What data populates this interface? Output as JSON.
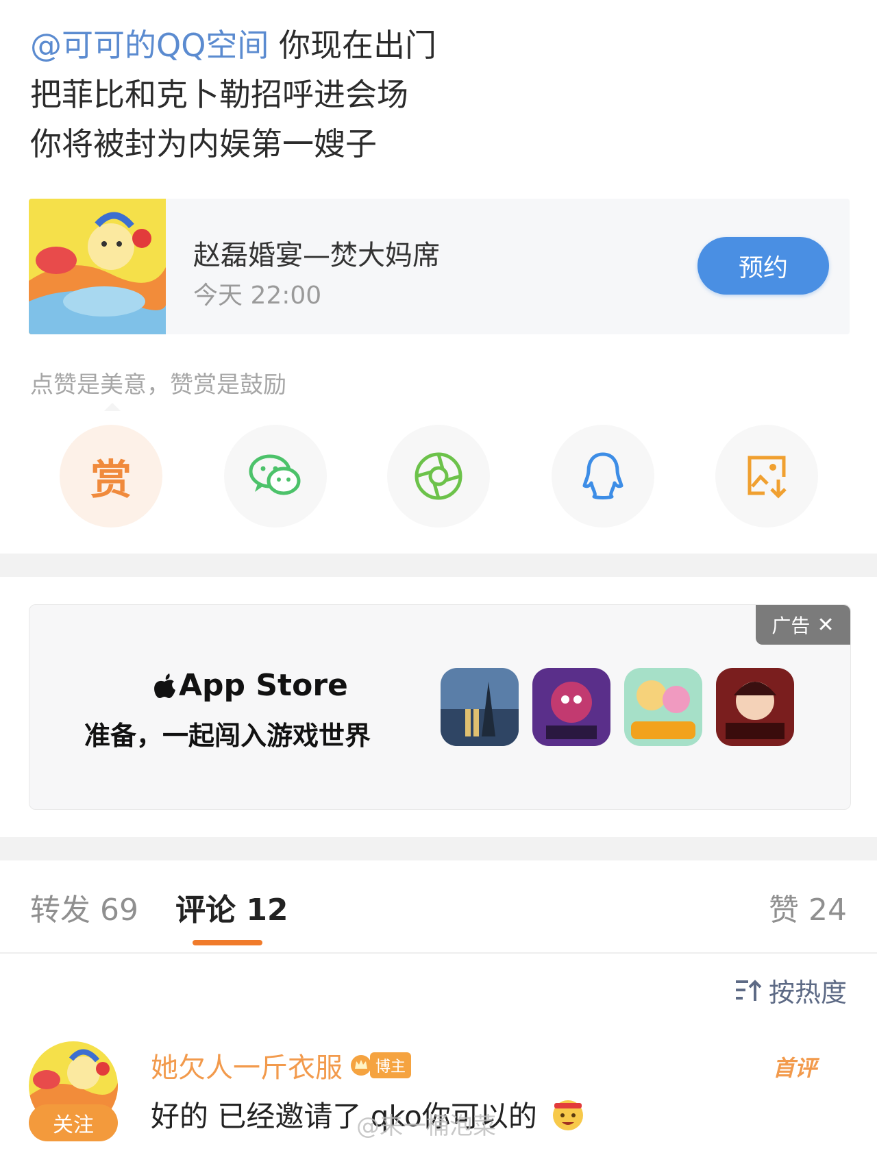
{
  "post": {
    "mention": "@可可的QQ空间",
    "line1_rest": " 你现在出门",
    "line2": "把菲比和克卜勒招呼进会场",
    "line3": "你将被封为内娱第一嫂子"
  },
  "event_card": {
    "title": "赵磊婚宴—焚大妈席",
    "time": "今天 22:00",
    "reserve_label": "预约"
  },
  "reward_tip": "点赞是美意，赞赏是鼓励",
  "share": {
    "reward_label": "赏",
    "icons": [
      "reward-icon",
      "wechat-icon",
      "moments-icon",
      "qq-icon",
      "save-image-icon"
    ]
  },
  "ad": {
    "tag": "广告",
    "brand": "App Store",
    "slogan": "准备，一起闯入游戏世界",
    "apps": [
      "app-icon-1",
      "app-icon-2",
      "app-icon-3",
      "app-icon-4"
    ]
  },
  "tabs": {
    "repost": "转发 69",
    "comment": "评论 12",
    "like": "赞 24"
  },
  "sort_label": "按热度",
  "comment": {
    "follow_label": "关注",
    "user": "她欠人一斤衣服",
    "badge": "博主",
    "first_tag": "首评",
    "text": "好的 已经邀请了 qko你可以的"
  },
  "watermark": "@来一桶泡菜",
  "colors": {
    "mention": "#5b8bd0",
    "reserve_button": "#4a8fe3",
    "accent_orange": "#f07b2b",
    "username": "#f29a4c"
  }
}
